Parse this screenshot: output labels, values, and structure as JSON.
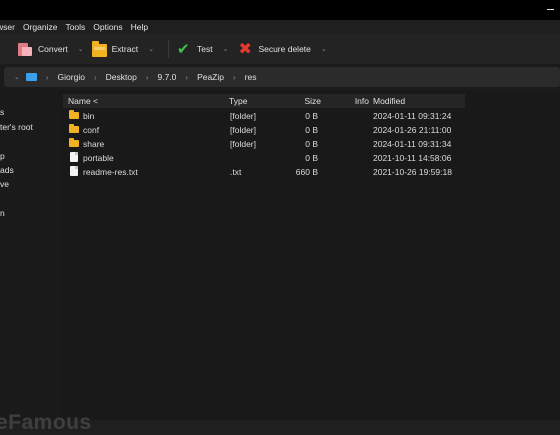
{
  "menu": [
    "wser",
    "Organize",
    "Tools",
    "Options",
    "Help"
  ],
  "toolbar": {
    "convert": "Convert",
    "extract": "Extract",
    "test": "Test",
    "secure_delete": "Secure delete"
  },
  "breadcrumb": [
    "Giorgio",
    "Desktop",
    "9.7.0",
    "PeaZip",
    "res"
  ],
  "sidebar": [
    "s",
    "ter's root",
    "p",
    "ads",
    "ve",
    "n"
  ],
  "columns": {
    "name": "Name <",
    "type": "Type",
    "size": "Size",
    "info": "Info",
    "modified": "Modified"
  },
  "files": [
    {
      "name": "bin",
      "type": "[folder]",
      "size": "0 B",
      "modified": "2024-01-11 09:31:24",
      "icon": "folder-icon"
    },
    {
      "name": "conf",
      "type": "[folder]",
      "size": "0 B",
      "modified": "2024-01-26 21:11:00",
      "icon": "folder-icon"
    },
    {
      "name": "share",
      "type": "[folder]",
      "size": "0 B",
      "modified": "2024-01-11 09:31:34",
      "icon": "folder-icon"
    },
    {
      "name": "portable",
      "type": "",
      "size": "0 B",
      "modified": "2021-10-11 14:58:06",
      "icon": "file-icon"
    },
    {
      "name": "readme-res.txt",
      "type": ".txt",
      "size": "660 B",
      "modified": "2021-10-26 19:59:18",
      "icon": "file-icon"
    }
  ],
  "watermark": "eFamous",
  "colors": {
    "folder": "#f2b120",
    "test_check": "#3fc24a",
    "delete_x": "#e33b2f",
    "computer": "#3aa0ea"
  }
}
